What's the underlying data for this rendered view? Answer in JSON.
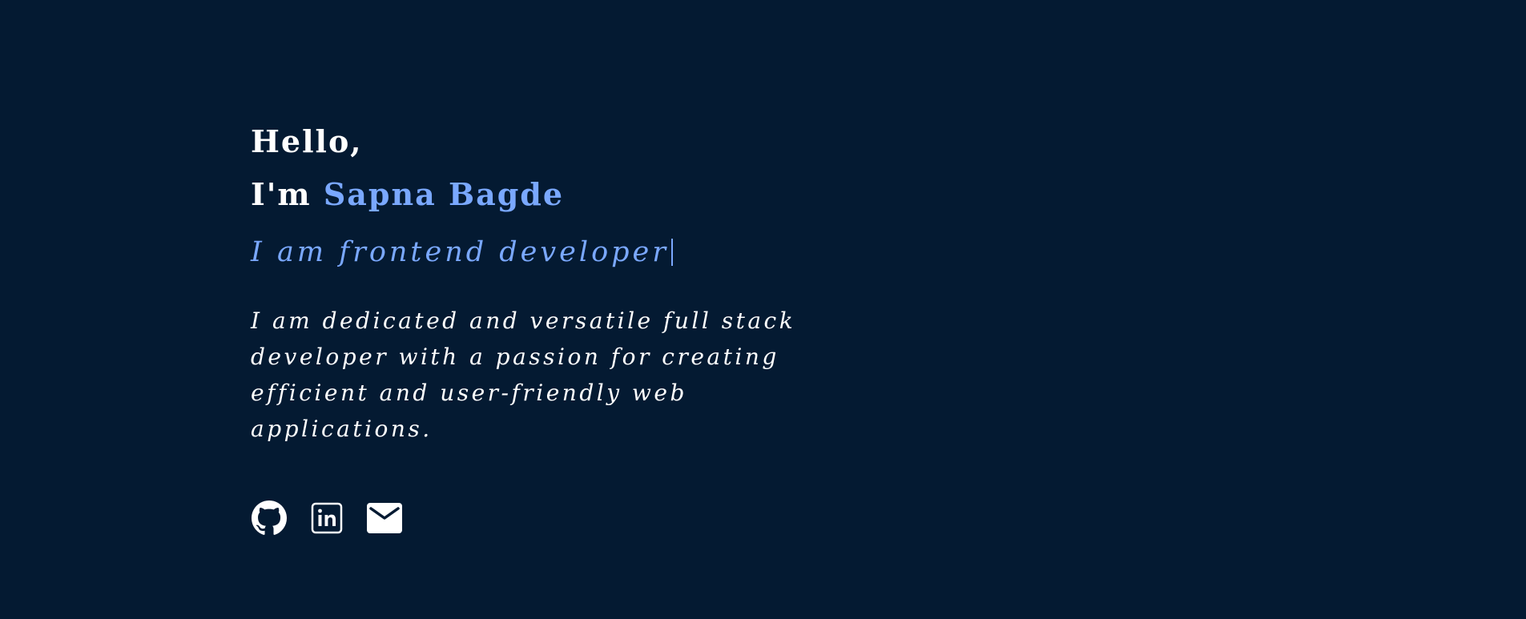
{
  "hero": {
    "greeting": "Hello,",
    "intro_prefix": "I'm ",
    "name": "Sapna Bagde",
    "role": "I am frontend developer",
    "bio": "I am dedicated and versatile full stack developer with a passion for creating efficient and user-friendly web applications."
  },
  "social": {
    "links": [
      {
        "icon": "github-icon"
      },
      {
        "icon": "linkedin-icon"
      },
      {
        "icon": "mail-icon"
      }
    ]
  },
  "colors": {
    "background": "#041a32",
    "text": "#ffffff",
    "accent": "#7aa8ff"
  }
}
